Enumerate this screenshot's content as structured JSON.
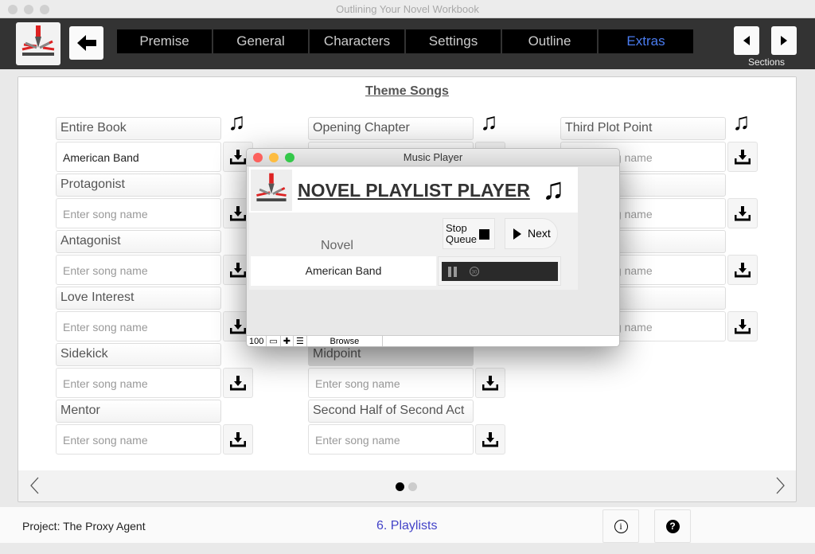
{
  "window": {
    "title": "Outlining Your Novel Workbook"
  },
  "toolbar": {
    "tabs": [
      {
        "label": "Premise",
        "active": false
      },
      {
        "label": "General",
        "active": false
      },
      {
        "label": "Characters",
        "active": false
      },
      {
        "label": "Settings",
        "active": false
      },
      {
        "label": "Outline",
        "active": false
      },
      {
        "label": "Extras",
        "active": true
      }
    ],
    "sections_label": "Sections",
    "back_icon": "arrow-left-icon",
    "accent_color": "#4a7cf0"
  },
  "main": {
    "heading": "Theme Songs",
    "placeholder": "Enter song name",
    "columns": [
      {
        "show_note": true,
        "items": [
          {
            "label": "Entire Book",
            "value": "American Band"
          },
          {
            "label": "Protagonist",
            "value": ""
          },
          {
            "label": "Antagonist",
            "value": ""
          },
          {
            "label": "Love Interest",
            "value": ""
          },
          {
            "label": "Sidekick",
            "value": ""
          },
          {
            "label": "Mentor",
            "value": ""
          }
        ]
      },
      {
        "show_note": true,
        "items": [
          {
            "label": "Opening Chapter",
            "value": ""
          },
          {
            "label": "",
            "value": ""
          },
          {
            "label": "",
            "value": ""
          },
          {
            "label": "",
            "value": ""
          },
          {
            "label": "Midpoint",
            "value": ""
          },
          {
            "label": "Second Half of Second Act",
            "value": ""
          }
        ]
      },
      {
        "show_note": true,
        "items": [
          {
            "label": "Third Plot Point",
            "value": ""
          },
          {
            "label": "",
            "value": ""
          },
          {
            "label": "",
            "value": ""
          },
          {
            "label": "",
            "value": ""
          }
        ]
      }
    ],
    "pager": {
      "pages": 2,
      "current": 1
    }
  },
  "footer": {
    "project": "Project:  The Proxy Agent",
    "step": "6. Playlists",
    "info_icon": "info-icon",
    "help_icon": "help-icon"
  },
  "music_player": {
    "title": "Music Player",
    "heading": "NOVEL PLAYLIST PLAYER",
    "novel_label": "Novel",
    "current_song": "American Band",
    "stop_queue": "Stop Queue",
    "next": "Next",
    "status": {
      "zoom": "100",
      "browse": "Browse"
    }
  }
}
